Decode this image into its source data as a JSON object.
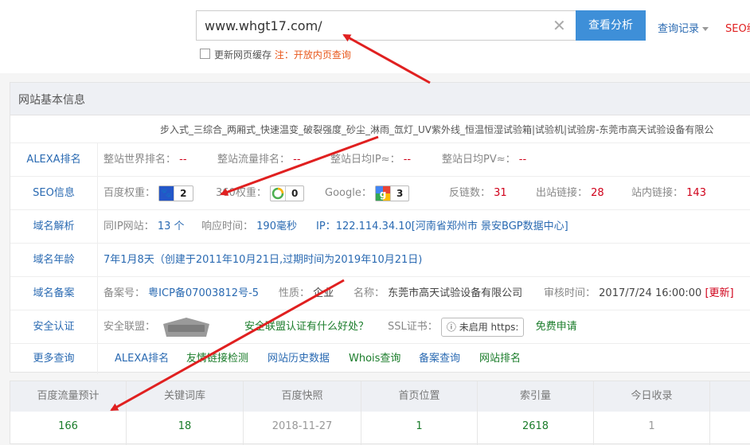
{
  "search": {
    "value": "www.whgt17.com/",
    "button": "查看分析",
    "history": "查询记录",
    "seo": "SEO综"
  },
  "cache": {
    "label": "更新网页缓存",
    "note": "注：开放内页查询"
  },
  "panel": {
    "title": "网站基本信息",
    "site_title": "步入式_三综合_两厢式_快速温变_破裂强度_砂尘_淋雨_氙灯_UV紫外线_恒温恒湿试验箱|试验机|试验房-东莞市高天试验设备有限公"
  },
  "alexa": {
    "label": "ALEXA排名",
    "world_k": "整站世界排名：",
    "world_v": "--",
    "traffic_k": "整站流量排名：",
    "traffic_v": "--",
    "ip_k": "整站日均IP≈：",
    "ip_v": "--",
    "pv_k": "整站日均PV≈：",
    "pv_v": "--"
  },
  "seo": {
    "label": "SEO信息",
    "baidu_k": "百度权重：",
    "baidu_v": "2",
    "so_k": "360权重：",
    "so_v": "0",
    "google_k": "Google：",
    "google_v": "3",
    "backlinks_k": "反链数：",
    "backlinks_v": "31",
    "outlinks_k": "出站链接：",
    "outlinks_v": "28",
    "inlinks_k": "站内链接：",
    "inlinks_v": "143"
  },
  "dns": {
    "label": "域名解析",
    "sameip_k": "同IP网站：",
    "sameip_v": "13 个",
    "resp_k": "响应时间：",
    "resp_v": "190毫秒",
    "ip_k": "IP：",
    "ip_v": "122.114.34.10[河南省郑州市 景安BGP数据中心]"
  },
  "age": {
    "label": "域名年龄",
    "value": "7年1月8天（创建于2011年10月21日,过期时间为2019年10月21日)"
  },
  "icp": {
    "label": "域名备案",
    "no_k": "备案号：",
    "no_v": "粤ICP备07003812号-5",
    "nature_k": "性质：",
    "nature_v": "企业",
    "name_k": "名称：",
    "name_v": "东莞市高天试验设备有限公司",
    "time_k": "审核时间：",
    "time_v": "2017/7/24 16:00:00",
    "update": "[更新]"
  },
  "security": {
    "label": "安全认证",
    "union_k": "安全联盟：",
    "stamp_top": "安全联盟",
    "stamp_mid": "官网验证",
    "stamp_bot": "未加入",
    "union_link": "安全联盟认证有什么好处？",
    "ssl_k": "SSL证书：",
    "ssl_btn": "未启用 https:",
    "ssl_link": "免费申请"
  },
  "more": {
    "label": "更多查询",
    "links": [
      "ALEXA排名",
      "友情链接检测",
      "网站历史数据",
      "Whois查询",
      "备案查询",
      "网站排名"
    ]
  },
  "stats": {
    "headers": [
      "百度流量预计",
      "关键词库",
      "百度快照",
      "首页位置",
      "索引量",
      "今日收录"
    ],
    "values": [
      "166",
      "18",
      "2018-11-27",
      "1",
      "2618",
      "1"
    ]
  },
  "colors": {
    "accent": "#3e8fd8",
    "link": "#2a6ab2",
    "red": "#d0021b",
    "green": "#1a7c2a",
    "arrow": "#e02020"
  }
}
